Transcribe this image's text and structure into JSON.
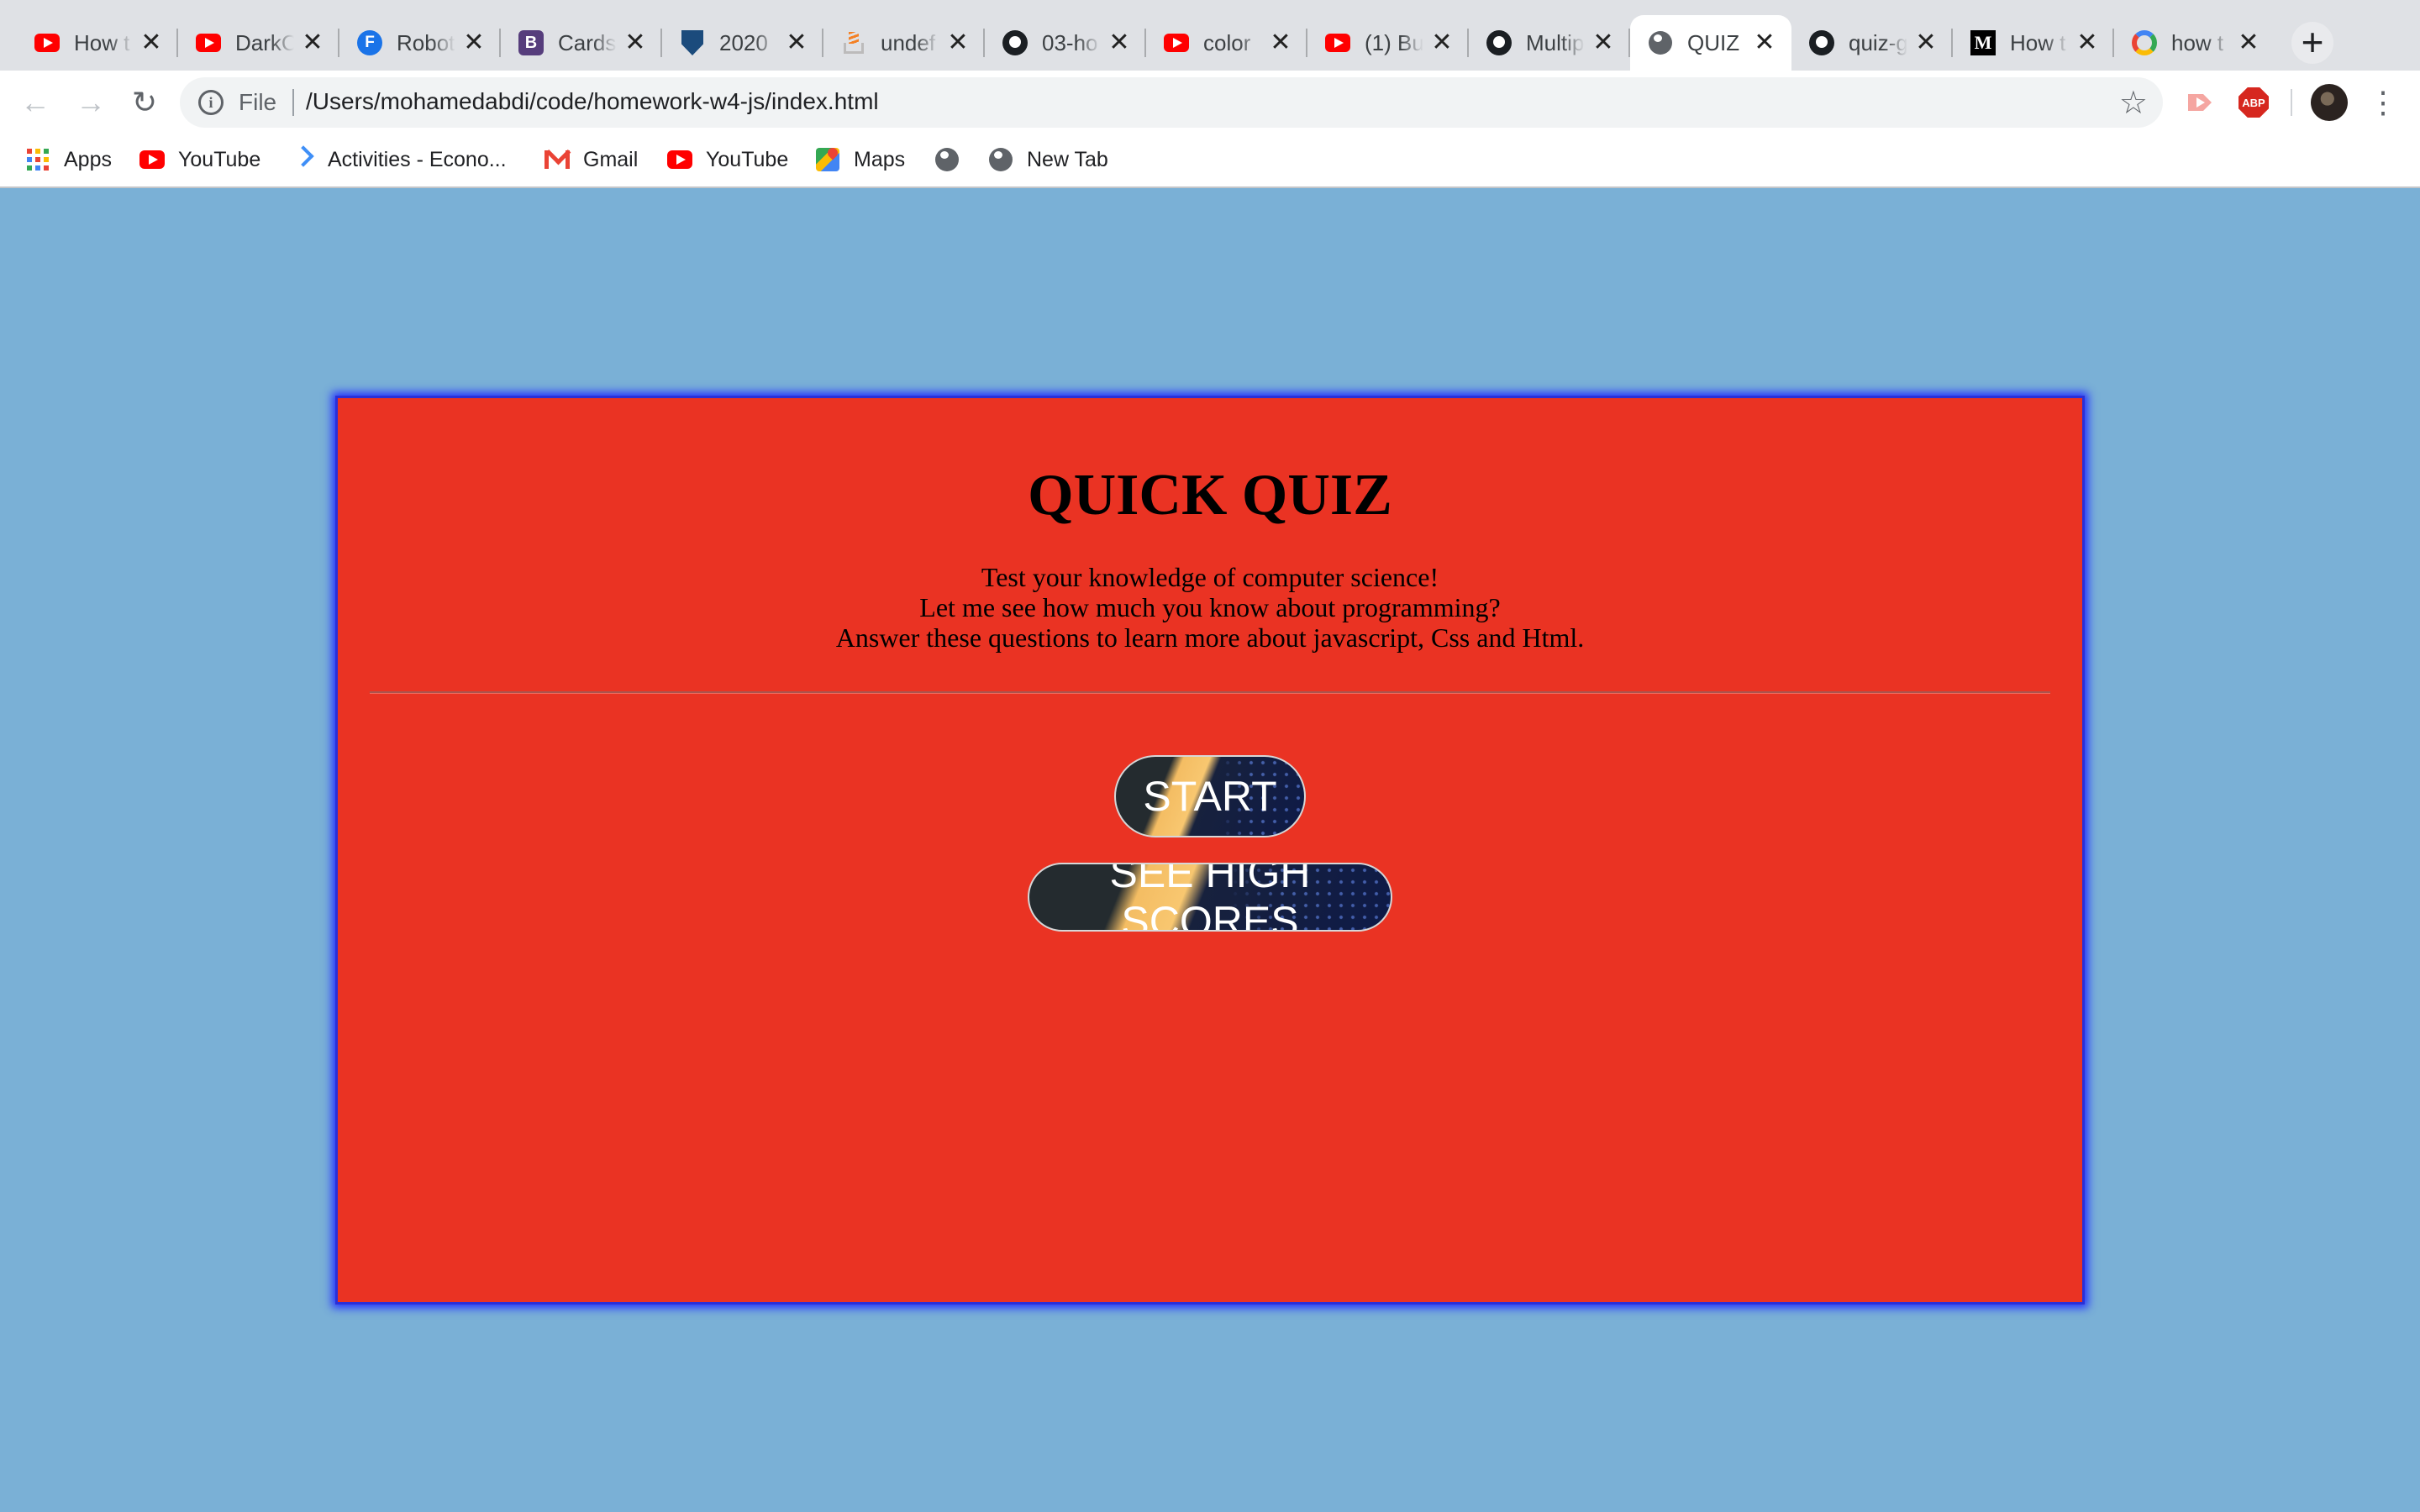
{
  "browser": {
    "tabs": [
      {
        "title": "How t",
        "icon": "youtube-icon"
      },
      {
        "title": "DarkC",
        "icon": "youtube-icon"
      },
      {
        "title": "Robot",
        "icon": "font-f-icon"
      },
      {
        "title": "Cards",
        "icon": "bootstrap-icon"
      },
      {
        "title": "2020",
        "icon": "shield-icon"
      },
      {
        "title": "undef",
        "icon": "stackoverflow-icon"
      },
      {
        "title": "03-ho",
        "icon": "github-icon"
      },
      {
        "title": "color",
        "icon": "youtube-icon"
      },
      {
        "title": "(1) Bu",
        "icon": "youtube-icon"
      },
      {
        "title": "Multip",
        "icon": "github-icon"
      },
      {
        "title": "QUIZ",
        "icon": "globe-icon",
        "active": true
      },
      {
        "title": "quiz-g",
        "icon": "github-icon"
      },
      {
        "title": "How t",
        "icon": "medium-icon"
      },
      {
        "title": "how t",
        "icon": "google-icon"
      }
    ],
    "new_tab_glyph": "+",
    "close_glyph": "✕",
    "address": {
      "scheme": "File",
      "url": "/Users/mohamedabdi/code/homework-w4-js/index.html"
    },
    "nav": {
      "back": "←",
      "forward": "→",
      "reload": "↻",
      "star": "☆",
      "menu": "⋮"
    },
    "extensions": {
      "abp_label": "ABP"
    },
    "bookmarks": [
      {
        "label": "Apps",
        "icon": "apps-grid-icon"
      },
      {
        "label": "YouTube",
        "icon": "youtube-icon"
      },
      {
        "label": "Activities - Econo...",
        "icon": "dl-icon"
      },
      {
        "label": "Gmail",
        "icon": "gmail-icon"
      },
      {
        "label": "YouTube",
        "icon": "youtube-icon"
      },
      {
        "label": "Maps",
        "icon": "maps-icon"
      },
      {
        "label": "",
        "icon": "globe-icon"
      },
      {
        "label": "New Tab",
        "icon": "globe-icon"
      }
    ]
  },
  "quiz": {
    "title": "QUICK QUIZ",
    "desc_lines": [
      "Test your knowledge of computer science!",
      "Let me see how much you know about programming?",
      "Answer these questions to learn more about javascript, Css and Html."
    ],
    "start_label": "START",
    "scores_label": "SEE HIGH SCORES"
  },
  "colors": {
    "page_bg": "#7ab0d6",
    "card_bg": "#ea3323",
    "card_border": "#2a2fd8",
    "button_stripe": "#f8c770"
  }
}
